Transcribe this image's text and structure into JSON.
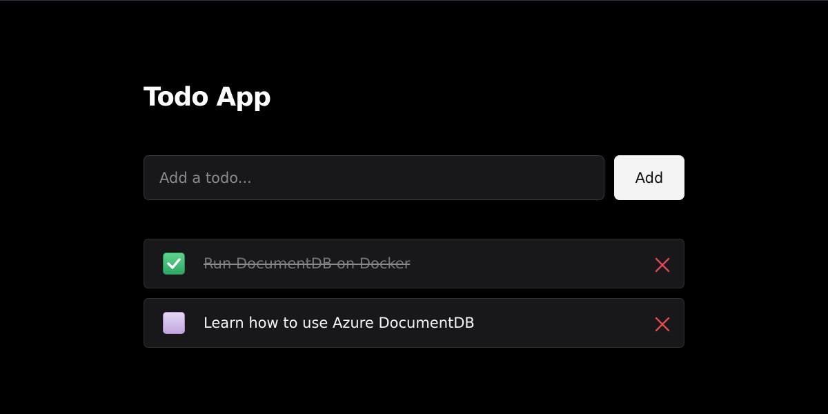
{
  "app": {
    "title": "Todo App"
  },
  "add_form": {
    "placeholder": "Add a todo...",
    "value": "",
    "button_label": "Add"
  },
  "todos": [
    {
      "text": "Run DocumentDB on Docker",
      "completed": true,
      "checkbox_icon": "check-icon",
      "delete_icon": "close-icon"
    },
    {
      "text": "Learn how to use Azure DocumentDB",
      "completed": false,
      "checkbox_icon": "empty-box-icon",
      "delete_icon": "close-icon"
    }
  ],
  "colors": {
    "background": "#000000",
    "surface": "#18181b",
    "checked": "#3fbf75",
    "unchecked": "#d2bdec",
    "delete": "#e5484d",
    "button": "#f4f4f5"
  }
}
